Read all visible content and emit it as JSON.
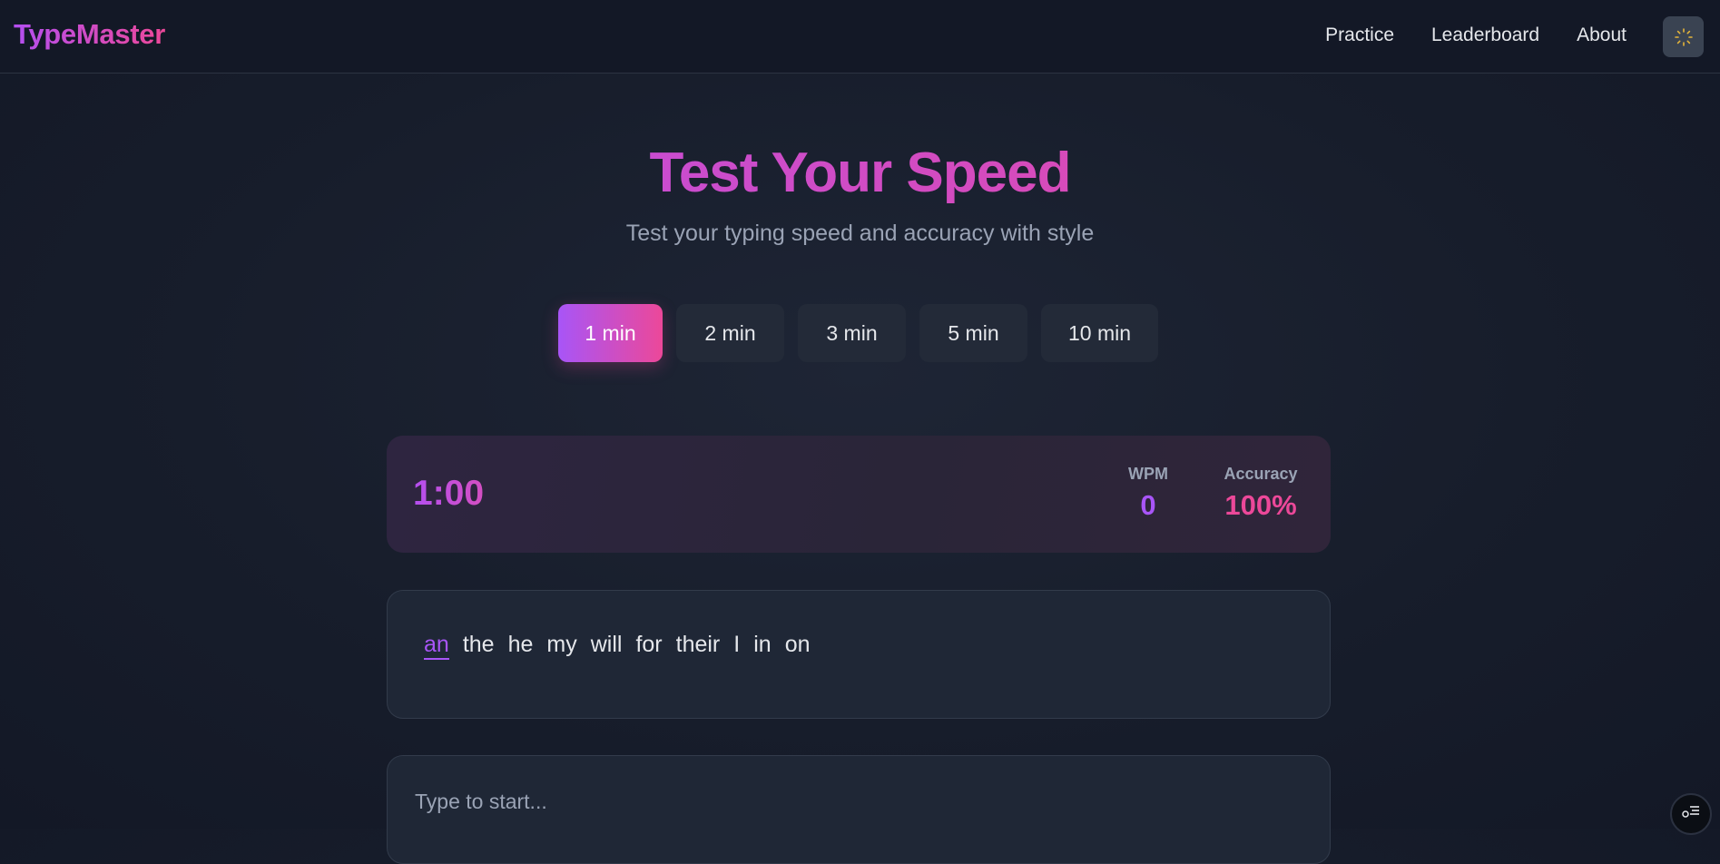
{
  "app": {
    "brand": "TypeMaster"
  },
  "nav": {
    "links": [
      "Practice",
      "Leaderboard",
      "About"
    ],
    "theme_icon": "sun-icon"
  },
  "hero": {
    "title": "Test Your Speed",
    "subtitle": "Test your typing speed and accuracy with style"
  },
  "durations": {
    "options": [
      "1 min",
      "2 min",
      "3 min",
      "5 min",
      "10 min"
    ],
    "selected": "1 min"
  },
  "stats": {
    "timer": "1:00",
    "wpm_label": "WPM",
    "wpm_value": "0",
    "accuracy_label": "Accuracy",
    "accuracy_value": "100%"
  },
  "words": [
    "an",
    "the",
    "he",
    "my",
    "will",
    "for",
    "their",
    "I",
    "in",
    "on"
  ],
  "current_word": "an",
  "input": {
    "placeholder": "Type to start..."
  },
  "colors": {
    "accent_purple": "#a855f7",
    "accent_pink": "#ec4899",
    "background": "#171d2b"
  },
  "fab": {
    "icon": "feedback-list-icon"
  }
}
